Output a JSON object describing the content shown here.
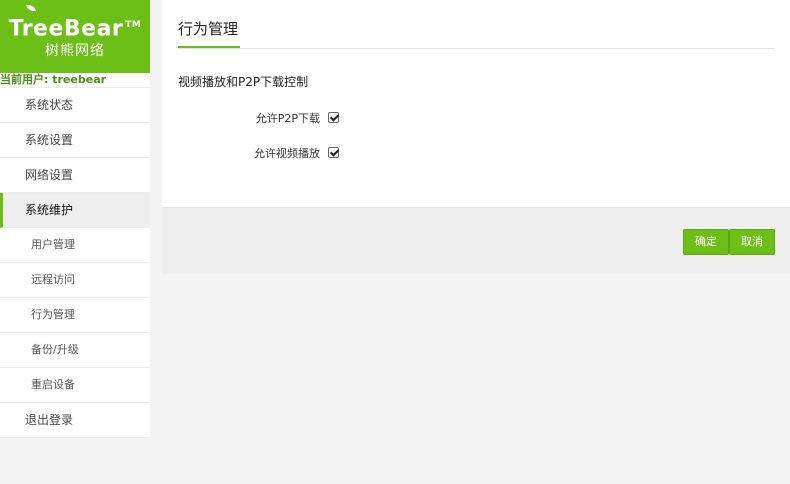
{
  "logo": {
    "brand": "TreeBear",
    "tm": "TM",
    "subtitle": "树熊网络"
  },
  "current_user": {
    "label": "当前用户:",
    "value": "treebear"
  },
  "sidebar": {
    "items": [
      {
        "label": "系统状态"
      },
      {
        "label": "系统设置"
      },
      {
        "label": "网络设置"
      },
      {
        "label": "系统维护"
      },
      {
        "label": "用户管理"
      },
      {
        "label": "远程访问"
      },
      {
        "label": "行为管理"
      },
      {
        "label": "备份/升级"
      },
      {
        "label": "重启设备"
      },
      {
        "label": "退出登录"
      }
    ]
  },
  "main": {
    "title": "行为管理",
    "section_title": "视频播放和P2P下载控制",
    "options": [
      {
        "label": "允许P2P下载",
        "checked": true
      },
      {
        "label": "允许视频播放",
        "checked": true
      }
    ],
    "buttons": {
      "confirm": "确定",
      "cancel": "取消"
    }
  },
  "colors": {
    "accent": "#6cbf16",
    "user_text": "#4a8e1a"
  },
  "icons": {
    "check": "checkmark-icon",
    "leaf": "leaf-icon"
  }
}
